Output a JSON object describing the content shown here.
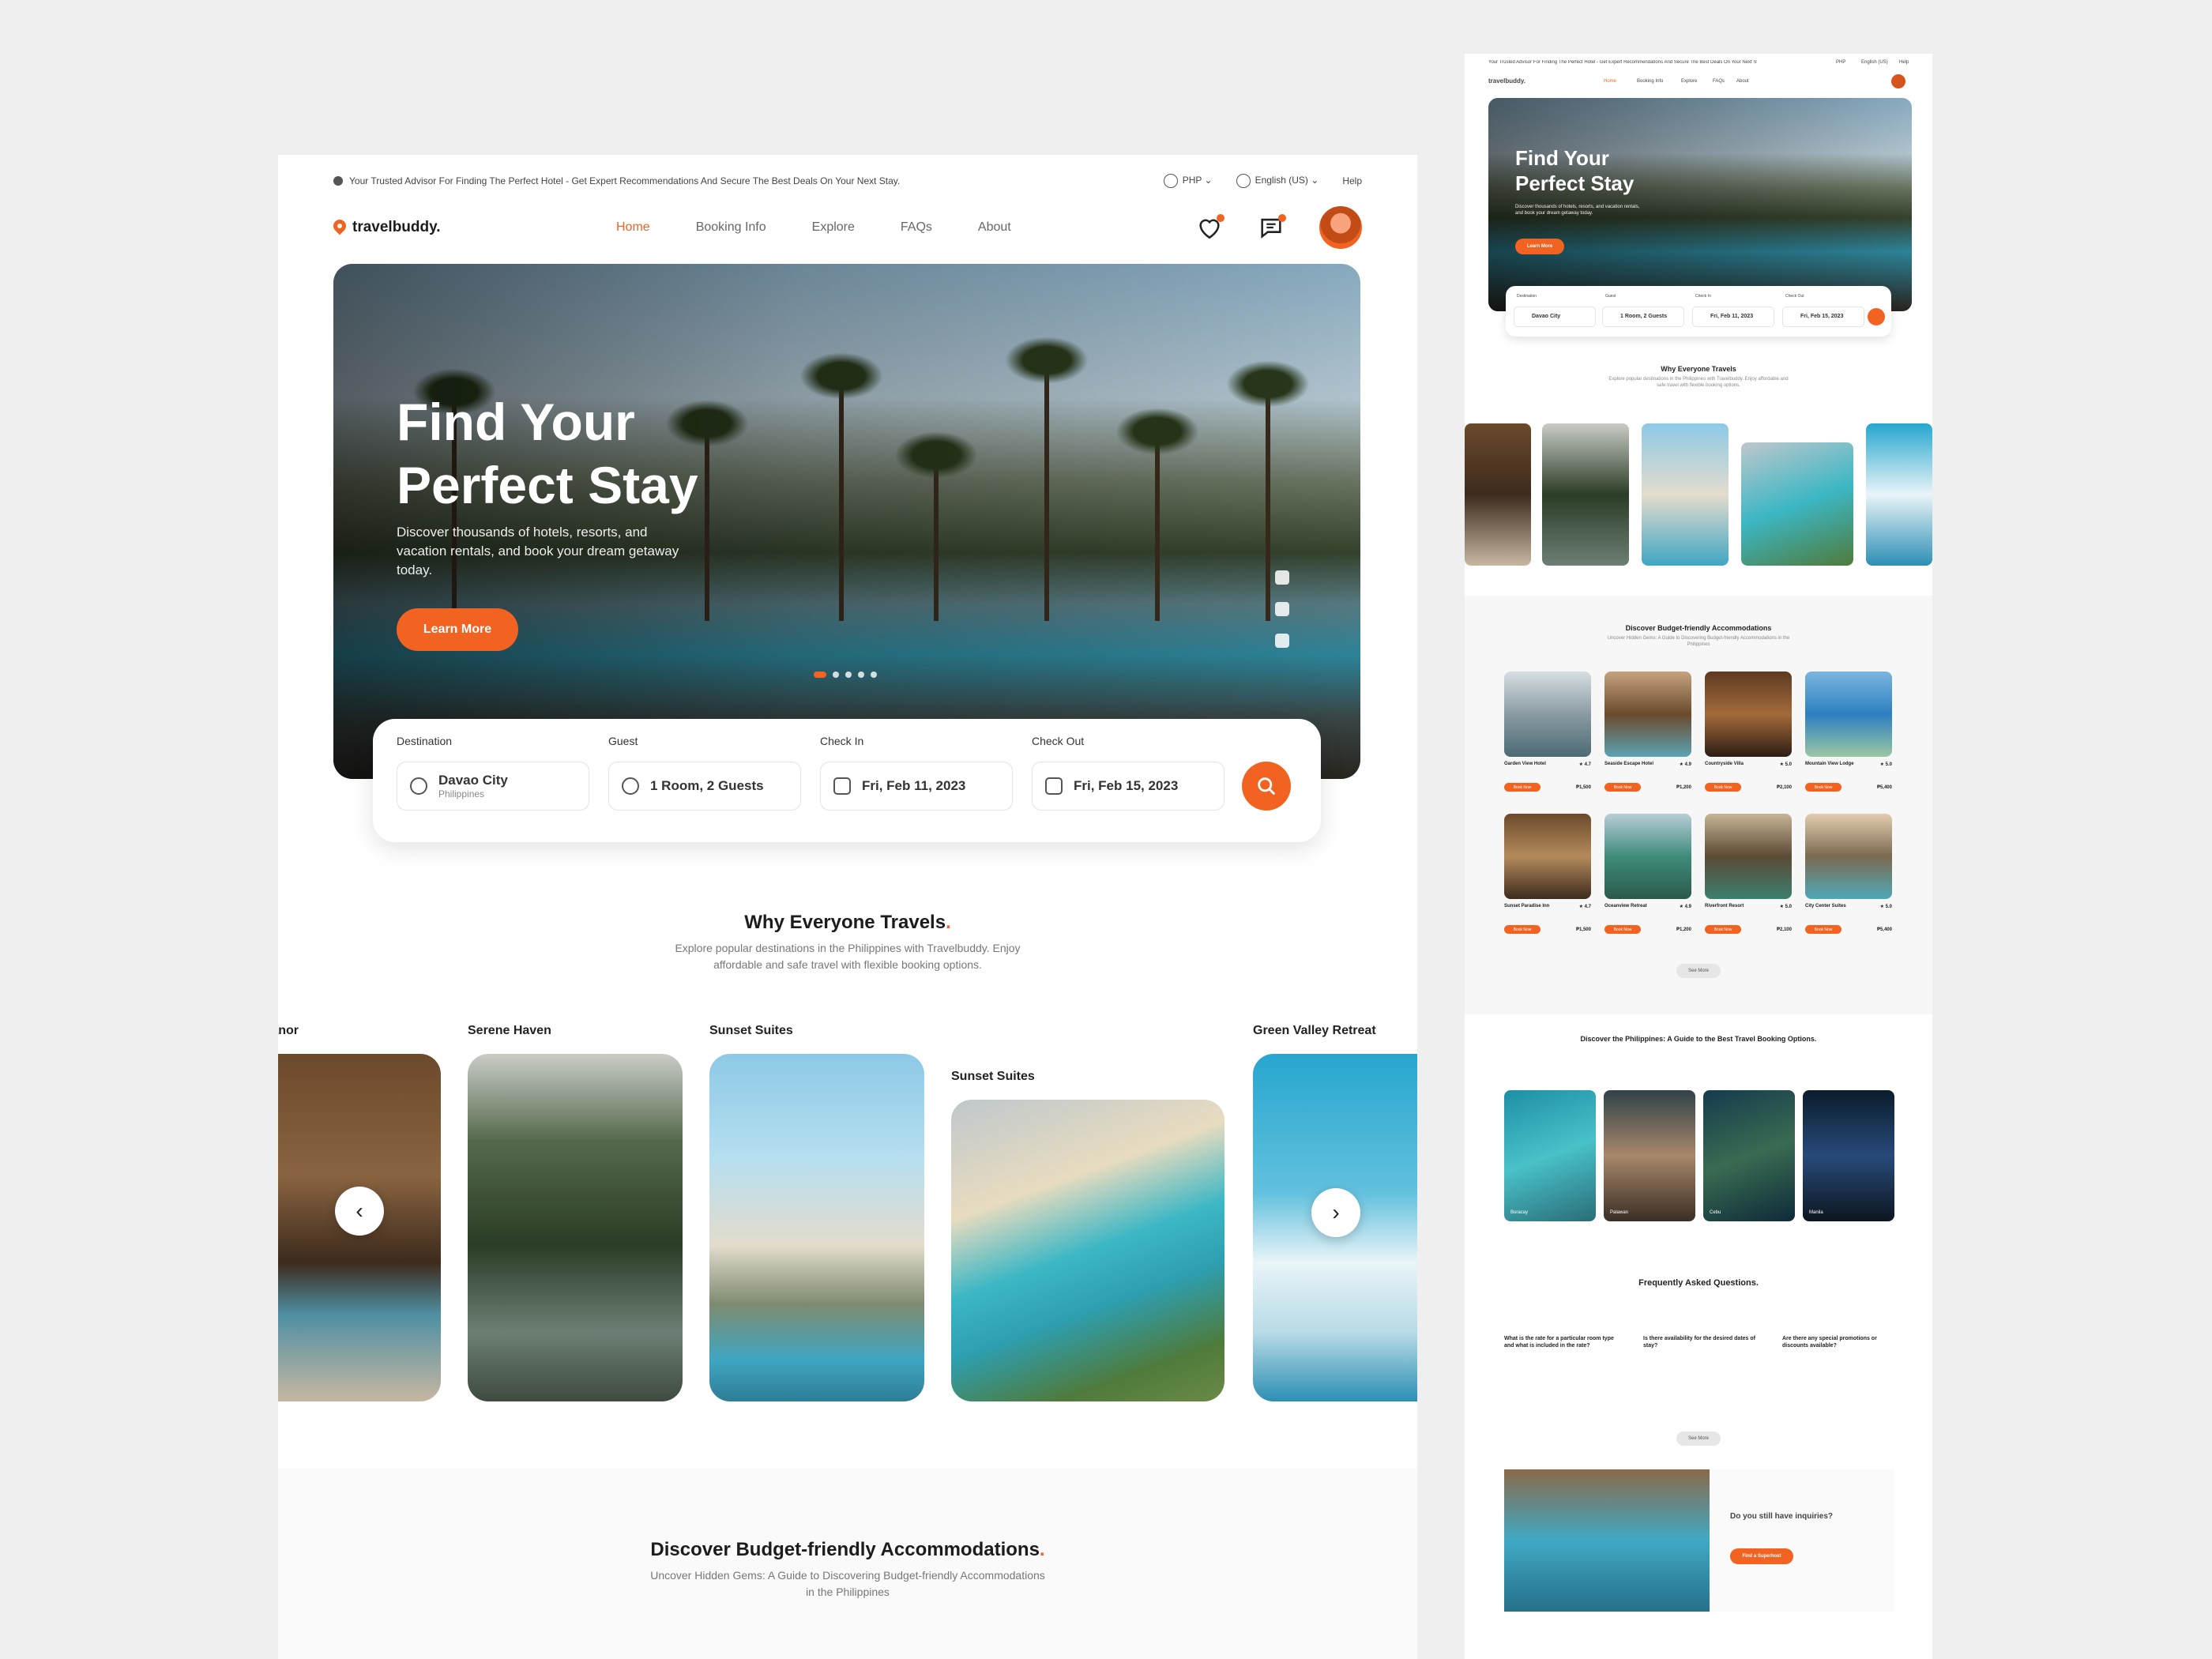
{
  "colors": {
    "accent": "#f26322",
    "background": "#efefef",
    "text": "#1c1c1c"
  },
  "topbar": {
    "tagline": "Your Trusted Advisor For Finding The Perfect Hotel - Get Expert Recommendations And Secure The Best Deals On Your Next Stay.",
    "currency": "PHP",
    "language": "English (US)",
    "help": "Help"
  },
  "brand": {
    "name": "travelbuddy."
  },
  "nav": {
    "links": [
      "Home",
      "Booking Info",
      "Explore",
      "FAQs",
      "About"
    ],
    "active": "Home"
  },
  "hero": {
    "title_line1": "Find Your",
    "title_line2": "Perfect Stay",
    "subtitle": "Discover thousands of hotels, resorts, and vacation rentals, and book your dream getaway today.",
    "cta": "Learn More",
    "slide_count": 5,
    "active_slide": 1
  },
  "search": {
    "destination_label": "Destination",
    "destination_value": "Davao City",
    "destination_sub": "Philippines",
    "guest_label": "Guest",
    "guest_value": "1 Room, 2 Guests",
    "checkin_label": "Check In",
    "checkin_value": "Fri, Feb 11, 2023",
    "checkout_label": "Check Out",
    "checkout_value": "Fri, Feb 15, 2023"
  },
  "why": {
    "title": "Why Everyone Travels",
    "subtitle": "Explore popular destinations in the Philippines with Travelbuddy. Enjoy affordable and safe travel with flexible booking options.",
    "cards": [
      "Manor",
      "Serene Haven",
      "Sunset Suites",
      "Sunset Suites",
      "Green Valley Retreat"
    ]
  },
  "budget": {
    "title": "Discover Budget-friendly Accommodations",
    "subtitle": "Uncover Hidden Gems: A Guide to Discovering Budget-friendly Accommodations in the Philippines",
    "book_label": "Book Now",
    "see_more": "See More",
    "hotels": [
      {
        "name": "Garden View Hotel",
        "rating": "4.7",
        "price": "₱1,500"
      },
      {
        "name": "Seaside Escape Hotel",
        "rating": "4.9",
        "price": "₱1,200"
      },
      {
        "name": "Countryside Villa",
        "rating": "5.0",
        "price": "₱2,100"
      },
      {
        "name": "Mountain View Lodge",
        "rating": "5.0",
        "price": "₱5,400"
      },
      {
        "name": "Sunset Paradise Inn",
        "rating": "4.7",
        "price": "₱1,500"
      },
      {
        "name": "Oceanview Retreat",
        "rating": "4.9",
        "price": "₱1,200"
      },
      {
        "name": "Riverfront Resort",
        "rating": "5.0",
        "price": "₱2,100"
      },
      {
        "name": "City Center Suites",
        "rating": "5.0",
        "price": "₱5,400"
      }
    ]
  },
  "guide": {
    "title": "Discover the Philippines: A Guide to the Best Travel Booking Options.",
    "places": [
      "Boracay",
      "Palawan",
      "Cebu",
      "Manila"
    ]
  },
  "faq": {
    "title": "Frequently Asked Questions.",
    "questions": [
      "What is the rate for a particular room type and what is included in the rate?",
      "Is there availability for the desired dates of stay?",
      "Are there any special promotions or discounts available?"
    ],
    "see_more": "See More"
  },
  "inquiry": {
    "title": "Do you still have inquiries?",
    "cta": "Find a Superhost"
  }
}
